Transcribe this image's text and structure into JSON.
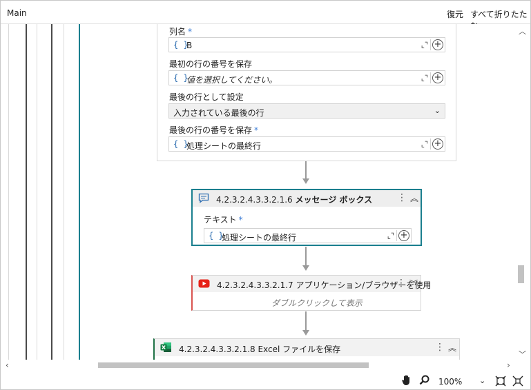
{
  "header": {
    "title": "Main",
    "restore_label": "復元",
    "collapse_all_label": "すべて折りたたむ"
  },
  "top_activity": {
    "fields": [
      {
        "label": "列名",
        "required": "*",
        "value": "B"
      },
      {
        "label": "最初の行の番号を保存",
        "required": "",
        "placeholder": "値を選択してください。"
      },
      {
        "label": "最後の行として設定",
        "required": "",
        "select_value": "入力されている最後の行"
      },
      {
        "label": "最後の行の番号を保存",
        "required": "*",
        "value": "処理シートの最終行"
      }
    ]
  },
  "message_box": {
    "number": "4.2.3.2.4.3.3.2.1.6",
    "name": "メッセージ ボックス",
    "text_label": "テキスト",
    "required": "*",
    "text_value": "処理シートの最終行"
  },
  "browser_activity": {
    "number": "4.2.3.2.4.3.3.2.1.7",
    "name": "アプリケーション/ブラウザーを使用",
    "hint": "ダブルクリックして表示"
  },
  "excel_activity": {
    "number": "4.2.3.2.4.3.3.2.1.8",
    "name": "Excel ファイルを保存"
  },
  "status": {
    "zoom": "100%"
  },
  "colors": {
    "accent_teal": "#1a7f8e",
    "browser_accent": "#d9534f",
    "excel_green": "#1e7145",
    "youtube_red": "#e62117"
  },
  "icons": {
    "message": "chat-bubble-icon",
    "browser": "youtube-play-icon",
    "excel": "excel-icon"
  }
}
